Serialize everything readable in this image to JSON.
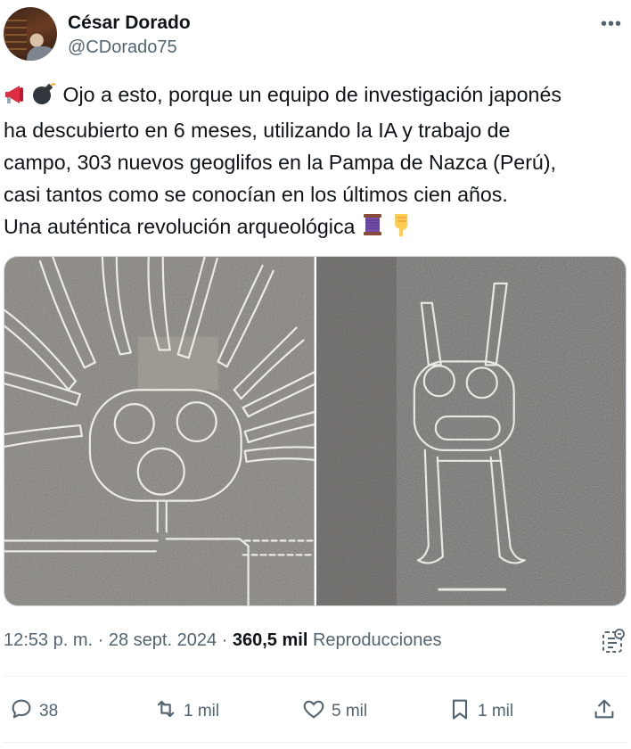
{
  "author": {
    "name": "César Dorado",
    "handle": "@CDorado75",
    "more_icon": "more-horizontal-icon"
  },
  "tweet": {
    "lines": [
      "Ojo a esto, porque un equipo de investigación japonés",
      "ha descubierto en 6 meses, utilizando la IA y trabajo de",
      "campo, 303 nuevos geoglifos en la Pampa de Nazca (Perú),",
      "casi tantos como se conocían en los últimos cien años.",
      "Una auténtica revolución arqueológica"
    ],
    "leading_emojis": [
      "megaphone-emoji",
      "bomb-emoji"
    ],
    "trailing_emojis": [
      "thread-spool-emoji",
      "pointing-down-emoji"
    ]
  },
  "media": {
    "images": [
      {
        "subject": "geoglyph-rayed-face"
      },
      {
        "subject": "geoglyph-horned-figure"
      }
    ]
  },
  "meta": {
    "time": "12:53 p. m.",
    "sep1": "·",
    "date": "28 sept. 2024",
    "sep2": "·",
    "views": "360,5 mil",
    "views_label": "Reproducciones"
  },
  "actions": {
    "replies": "38",
    "reposts": "1 mil",
    "likes": "5 mil",
    "bookmarks": "1 mil"
  },
  "colors": {
    "text": "#0f1419",
    "secondary": "#536471",
    "divider": "#eff3f4",
    "media_border": "#cfd9de"
  }
}
